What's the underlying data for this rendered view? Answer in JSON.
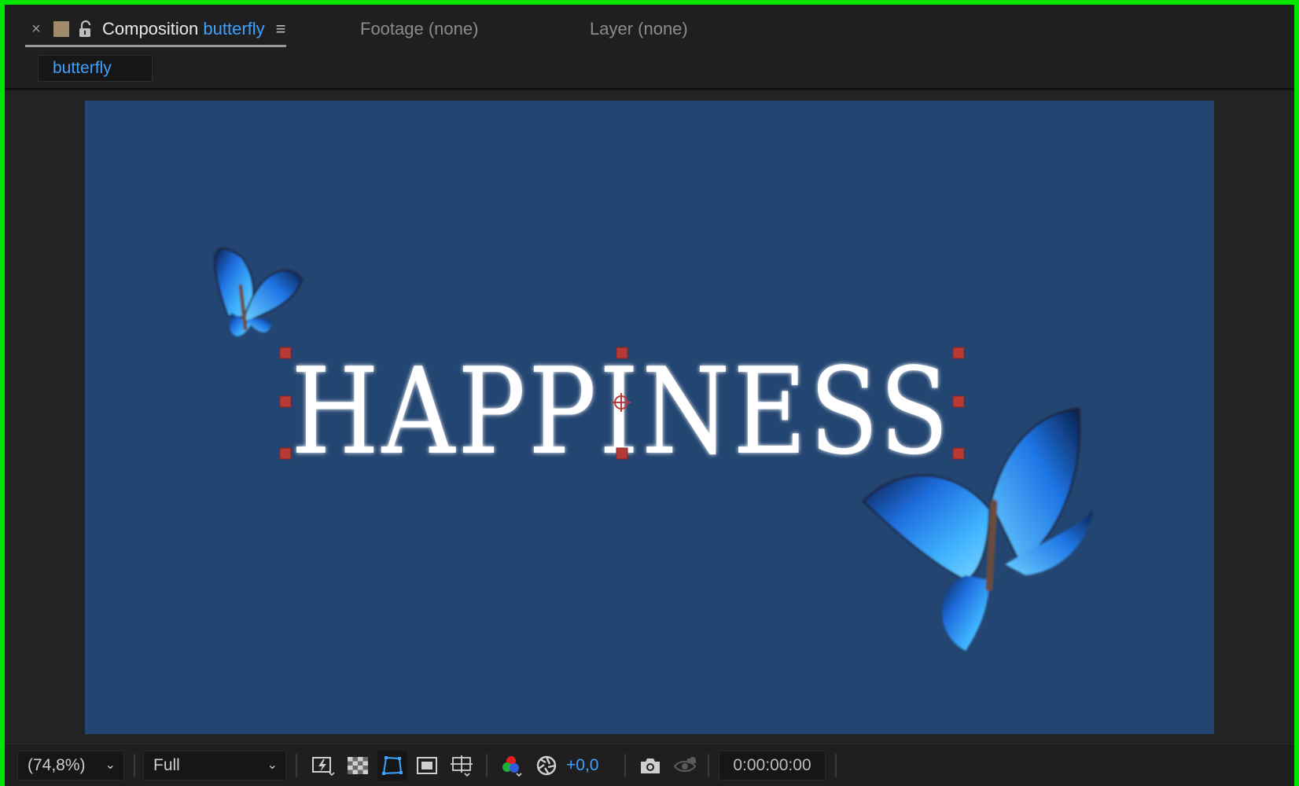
{
  "panel": {
    "close_label": "×",
    "title_prefix": "Composition",
    "composition_name": "butterfly",
    "footage_tab": "Footage (none)",
    "layer_tab": "Layer (none)",
    "active_comp_chip": "butterfly"
  },
  "composition": {
    "background_color": "#234571",
    "text_layer": "HAPPINESS"
  },
  "footer": {
    "zoom": "(74,8%)",
    "resolution": "Full",
    "exposure": "+0,0",
    "timecode": "0:00:00:00"
  },
  "colors": {
    "accent": "#3ea2ff",
    "frame_border": "#00e600",
    "handle": "#b73a36"
  },
  "icons": [
    "close-icon",
    "label-color-swatch",
    "lock-icon",
    "menu-icon",
    "chevron-down-icon",
    "fast-preview-icon",
    "transparency-grid-icon",
    "mask-path-icon",
    "region-of-interest-icon",
    "grid-guides-icon",
    "rgb-channels-icon",
    "exposure-reset-icon",
    "snapshot-camera-icon",
    "show-snapshot-icon"
  ]
}
